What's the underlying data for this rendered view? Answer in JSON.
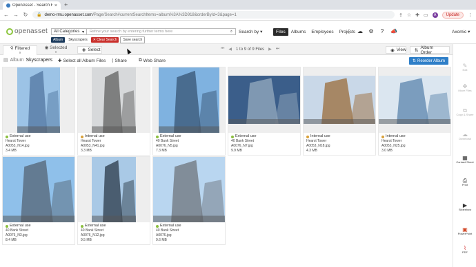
{
  "browser": {
    "tab_title": "OpenAsset - Search Results",
    "tab_close": "×",
    "new_tab": "+",
    "url_host": "demo-rmu.openasset.com",
    "url_path": "/Page/Search#currentSearchItems=album%3A%3D918&orderById=3&page=1",
    "update_label": "Update",
    "profile_initial": "A"
  },
  "header": {
    "logo_text": "openasset",
    "category_select": "All Categories",
    "search_placeholder": "Refine your search by entering further terms here",
    "search_by": "Search by",
    "chips": {
      "album": "Album",
      "album_value": "Skyscrapers",
      "clear": "Clear Search",
      "save": "Save search"
    },
    "nav": {
      "files": "Files",
      "albums": "Albums",
      "employees": "Employees",
      "projects": "Projects"
    },
    "user": "Axomic"
  },
  "toolbar": {
    "filtered": "Filtered",
    "filtered_count": "9",
    "selected": "Selected",
    "selected_count": "0",
    "select": "Select",
    "pager": "1 to 9 of 9 Files",
    "view": "View",
    "album_order": "Album Order"
  },
  "subheader": {
    "album_label": "Album",
    "album_name": "Skyscrapers",
    "select_all": "Select all Album Files",
    "share": "Share",
    "web_share": "Web Share",
    "reorder": "Reorder Album"
  },
  "files": [
    {
      "usage": "External use",
      "project": "Hearst Tower",
      "filename": "A0053_N14.jpg",
      "size": "3.4 MB",
      "status": "green"
    },
    {
      "usage": "Internal use",
      "project": "Hearst Tower",
      "filename": "A0053_N41.jpg",
      "size": "3.3 MB",
      "status": "amber"
    },
    {
      "usage": "External use",
      "project": "40 Bank Street",
      "filename": "A0076_N5.jpg",
      "size": "7.3 MB",
      "status": "green"
    },
    {
      "usage": "External use",
      "project": "40 Bank Street",
      "filename": "A0076_N7.jpg",
      "size": "9.9 MB",
      "status": "green"
    },
    {
      "usage": "Internal use",
      "project": "Hearst Tower",
      "filename": "A0053_N18.jpg",
      "size": "4.3 MB",
      "status": "amber"
    },
    {
      "usage": "Internal use",
      "project": "Hearst Tower",
      "filename": "A0053_N25.jpg",
      "size": "3.0 MB",
      "status": "amber"
    },
    {
      "usage": "External use",
      "project": "40 Bank Street",
      "filename": "A0076_N3.jpg",
      "size": "8.4 MB",
      "status": "green"
    },
    {
      "usage": "External use",
      "project": "40 Bank Street",
      "filename": "A0076_N12.jpg",
      "size": "9.5 MB",
      "status": "green"
    },
    {
      "usage": "External use",
      "project": "40 Bank Street",
      "filename": "A0076.jpg",
      "size": "9.6 MB",
      "status": "green"
    }
  ],
  "right_panel": {
    "edit": "Edit",
    "move_files": "Move Files",
    "copy": "Copy & Share",
    "download": "Download",
    "contact_sheet": "Contact Sheet",
    "print": "Print",
    "slideshow": "Slideshow",
    "powerpoint": "PowerPoint",
    "pdf": "PDF"
  },
  "colors": {
    "accent": "#2f7fc8",
    "logo_green": "#8dc63f",
    "clear_red": "#c9302c",
    "external_green": "#8bbf3f",
    "internal_amber": "#d9a13a"
  }
}
